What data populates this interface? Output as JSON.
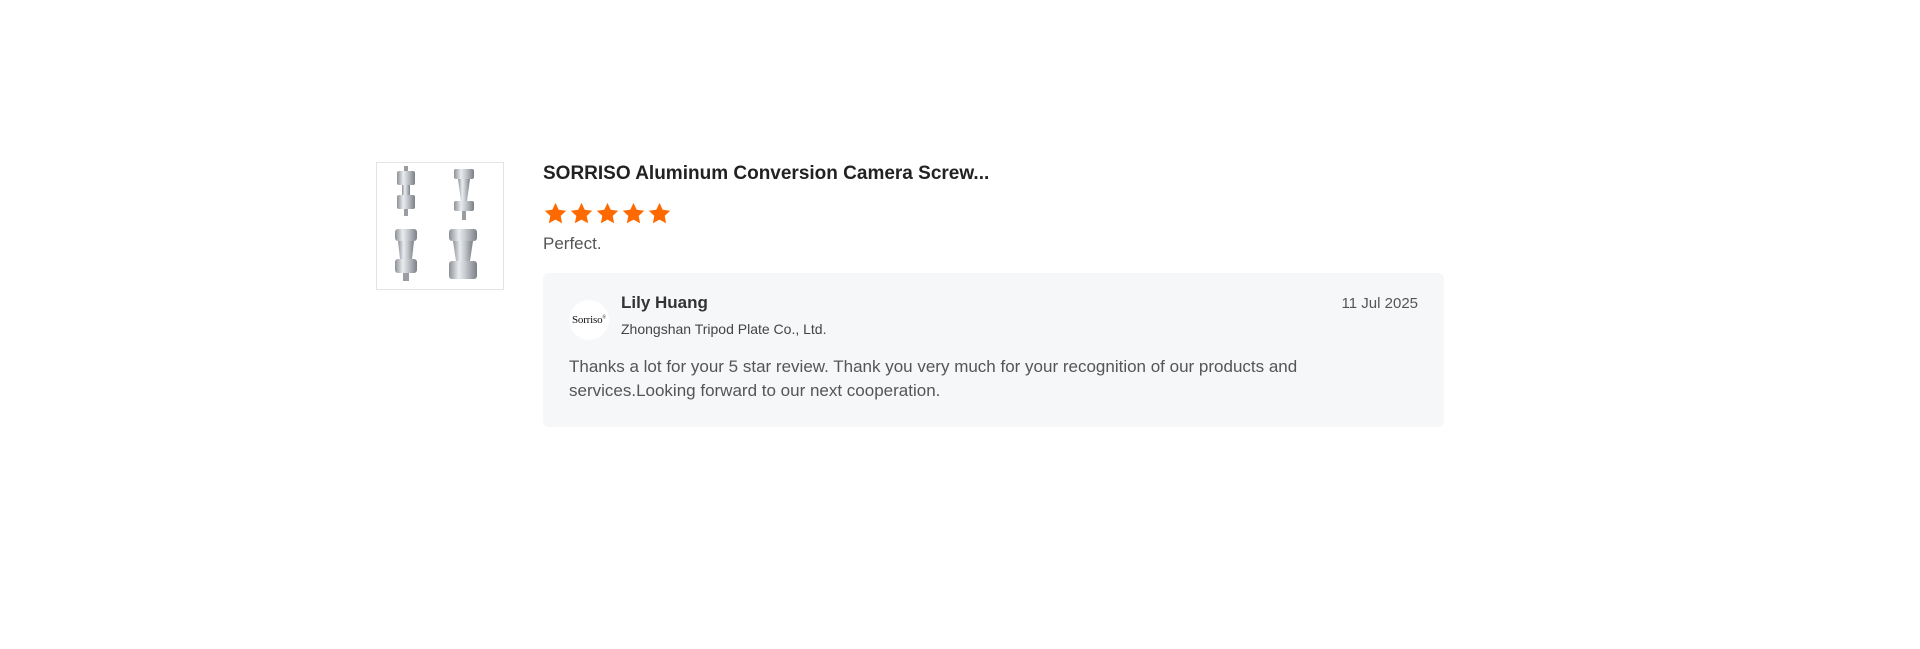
{
  "review": {
    "product_title": "SORRISO Aluminum Conversion Camera Screw...",
    "product_image": "product-thumbnail-icon",
    "rating": 5,
    "rating_max": 5,
    "star_color": "#ff6a00",
    "comment": "Perfect.",
    "reply": {
      "avatar_logo": "Sorriso",
      "avatar_logo_mark": "®",
      "name": "Lily Huang",
      "company": "Zhongshan Tripod Plate Co., Ltd.",
      "date": "11 Jul 2025",
      "text": "Thanks a lot for your 5 star review.  Thank you very much for your recognition of our products and services.Looking forward to our next cooperation.",
      "background": "#f6f7f8"
    }
  }
}
